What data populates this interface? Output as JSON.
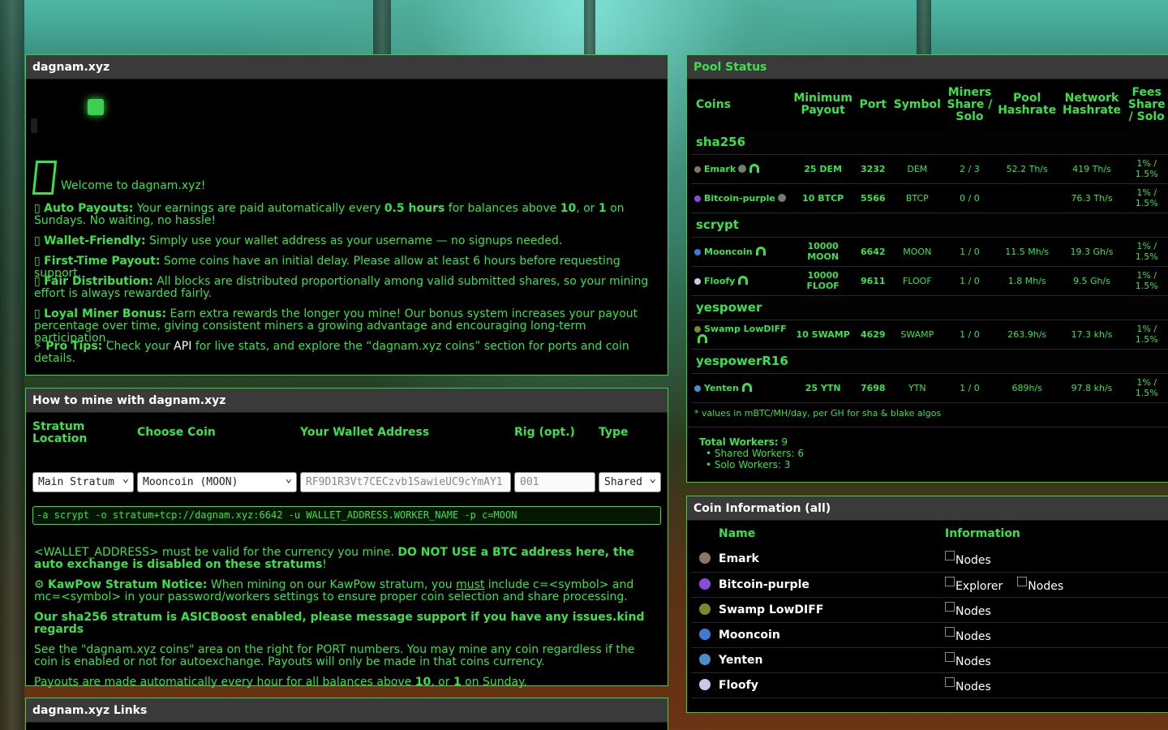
{
  "welcome_panel": {
    "title": "dagnam.xyz",
    "welcome": "Welcome to dagnam.xyz!",
    "items": [
      {
        "icon": "",
        "bold": "Auto Payouts:",
        "text": " Your earnings are paid automatically every ",
        "b1": "0.5 hours",
        "t2": " for balances above ",
        "b2": "10",
        "t3": ", or ",
        "b3": "1",
        "t4": " on Sundays. No waiting, no hassle!"
      },
      {
        "icon": "",
        "bold": "Wallet-Friendly:",
        "text": " Simply use your wallet address as your username — no signups needed."
      },
      {
        "icon": "",
        "bold": "First-Time Payout:",
        "text": " Some coins have an initial delay. Please allow at least 6 hours before requesting support."
      },
      {
        "icon": "",
        "bold": "Fair Distribution:",
        "text": " All blocks are distributed proportionally among valid submitted shares, so your mining effort is always rewarded fairly."
      },
      {
        "icon": "",
        "bold": "Loyal Miner Bonus:",
        "text": " Earn extra rewards the longer you mine! Our bonus system increases your payout percentage over time, giving consistent miners a growing advantage and encouraging long-term participation."
      },
      {
        "icon": "⚡",
        "bold": "Pro Tips:",
        "text": " Check your ",
        "api": "API",
        "t2": " for live stats, and explore the “dagnam.xyz coins” section for ports and coin details."
      }
    ]
  },
  "how_panel": {
    "title": "How to mine with dagnam.xyz",
    "labels": {
      "stratum": "Stratum Location",
      "coin": "Choose Coin",
      "wallet": "Your Wallet Address",
      "rig": "Rig (opt.)",
      "type": "Type"
    },
    "stratum_value": "Main Stratum",
    "coin_value": "Mooncoin (MOON)",
    "wallet_placeholder": "RF9D1R3Vt7CECzvb1SawieUC9cYmAY1",
    "rig_placeholder": "001",
    "type_value": "Shared",
    "command": "-a scrypt -o stratum+tcp://dagnam.xyz:6642 -u WALLET_ADDRESS.WORKER_NAME -p c=MOON",
    "note1_a": "<WALLET_ADDRESS> must be valid for the currency you mine. ",
    "note1_b": "DO NOT USE a BTC address here, the auto exchange is disabled on these stratums",
    "note1_c": "!",
    "kawpow_icon": "⚙",
    "kawpow_bold": "KawPow Stratum Notice:",
    "kawpow_a": " When mining on our KawPow stratum, you ",
    "kawpow_must": "must",
    "kawpow_b": " include c=<symbol> and mc=<symbol> in your password/workers settings to ensure proper coin selection and share processing.",
    "asicboost": "Our sha256 stratum is ASICBoost enabled, please message support if you have any issues.kind regards",
    "ports_note": "See the \"dagnam.xyz coins\" area on the right for PORT numbers. You may mine any coin regardless if the coin is enabled or not for autoexchange. Payouts will only be made in that coins currency.",
    "payout_a": "Payouts are made automatically every hour for all balances above ",
    "payout_b": "10",
    "payout_c": ", or ",
    "payout_d": "1",
    "payout_e": " on Sunday."
  },
  "links_panel": {
    "title": "dagnam.xyz Links"
  },
  "pool_status": {
    "title": "Pool Status",
    "headers": [
      "Coins",
      "Minimum Payout",
      "Port",
      "Symbol",
      "Miners Share / Solo",
      "Pool Hashrate",
      "Network Hashrate",
      "Fees Share / Solo"
    ],
    "groups": [
      {
        "algo": "sha256",
        "rows": [
          {
            "name": "Emark",
            "color": "#8a7560",
            "min": "25 DEM",
            "port": "3232",
            "symbol": "DEM",
            "miners": "2 / 3",
            "pool": "52.2 Th/s",
            "net": "419 Th/s",
            "fees": "1% / 1.5%"
          },
          {
            "name": "Bitcoin-purple",
            "color": "#8a4bd8",
            "min": "10 BTCP",
            "port": "5566",
            "symbol": "BTCP",
            "miners": "0 / 0",
            "pool": "",
            "net": "76.3 Th/s",
            "fees": "1% / 1.5%"
          }
        ]
      },
      {
        "algo": "scrypt",
        "rows": [
          {
            "name": "Mooncoin",
            "color": "#3d7bd8",
            "min": "10000 MOON",
            "port": "6642",
            "symbol": "MOON",
            "miners": "1 / 0",
            "pool": "11.5 Mh/s",
            "net": "19.3 Gh/s",
            "fees": "1% / 1.5%"
          },
          {
            "name": "Floofy",
            "color": "#c8c8e8",
            "min": "10000 FLOOF",
            "port": "9611",
            "symbol": "FLOOF",
            "miners": "1 / 0",
            "pool": "1.8 Mh/s",
            "net": "9.5 Gh/s",
            "fees": "1% / 1.5%"
          }
        ]
      },
      {
        "algo": "yespower",
        "rows": [
          {
            "name": "Swamp LowDIFF",
            "color": "#7a8a2a",
            "min": "10 SWAMP",
            "port": "4629",
            "symbol": "SWAMP",
            "miners": "1 / 0",
            "pool": "263.9h/s",
            "net": "17.3 kh/s",
            "fees": "1% / 1.5%"
          }
        ]
      },
      {
        "algo": "yespowerR16",
        "rows": [
          {
            "name": "Yenten",
            "color": "#4a90c8",
            "min": "25 YTN",
            "port": "7698",
            "symbol": "YTN",
            "miners": "1 / 0",
            "pool": "689h/s",
            "net": "97.8 kh/s",
            "fees": "1% / 1.5%"
          }
        ]
      }
    ],
    "footnote": "* values in mBTC/MH/day, per GH for sha & blake algos",
    "total_workers_label": "Total Workers:",
    "total_workers": "9",
    "shared_workers": "• Shared Workers: 6",
    "solo_workers": "• Solo Workers: 3"
  },
  "coin_info": {
    "title": "Coin Information (all)",
    "headers": [
      "Name",
      "Information"
    ],
    "rows": [
      {
        "name": "Emark",
        "color": "#8a7560",
        "links": [
          "Nodes"
        ]
      },
      {
        "name": "Bitcoin-purple",
        "color": "#8a4bd8",
        "links": [
          "Explorer",
          "Nodes"
        ]
      },
      {
        "name": "Swamp LowDIFF",
        "color": "#7a8a2a",
        "links": [
          "Nodes"
        ]
      },
      {
        "name": "Mooncoin",
        "color": "#3d7bd8",
        "links": [
          "Nodes"
        ]
      },
      {
        "name": "Yenten",
        "color": "#4a90c8",
        "links": [
          "Nodes"
        ]
      },
      {
        "name": "Floofy",
        "color": "#c8c8e8",
        "links": [
          "Nodes"
        ]
      }
    ]
  }
}
